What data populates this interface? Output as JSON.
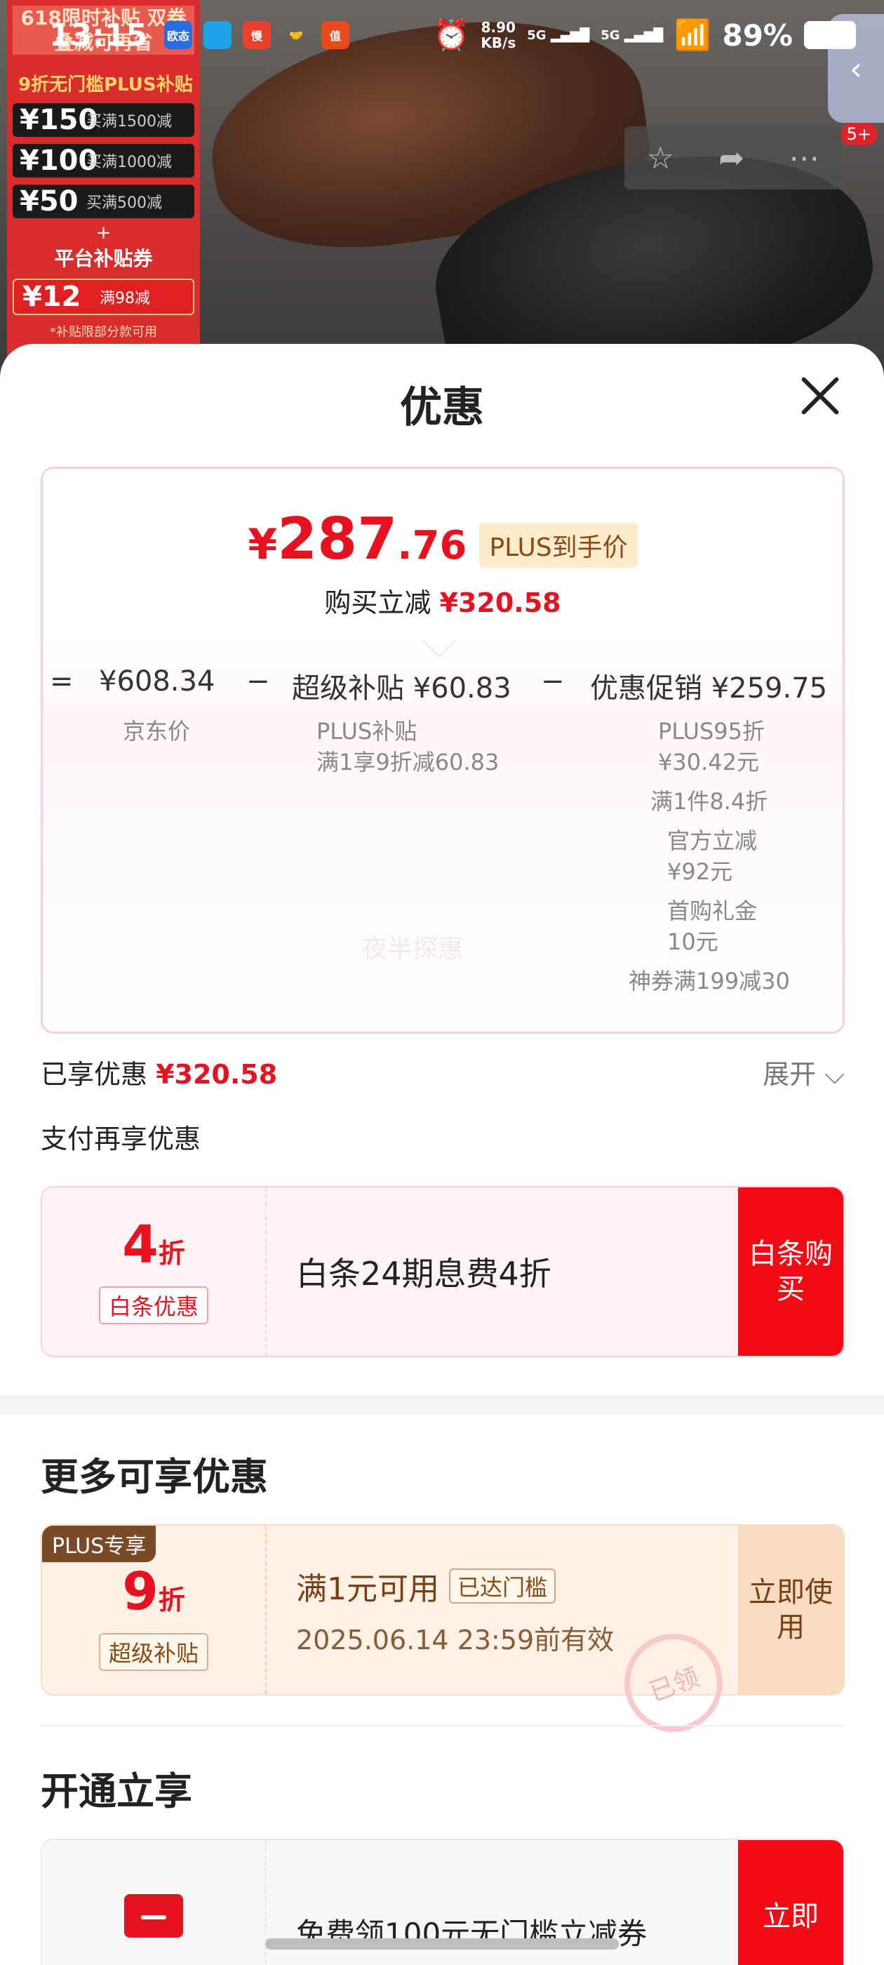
{
  "status_bar": {
    "time": "13:15",
    "net_speed_value": "8.90",
    "net_speed_unit": "KB/s",
    "sig1": "5G",
    "sig2": "5G",
    "battery": "89%",
    "apps": [
      "欧态",
      "",
      "慢",
      "",
      "值"
    ]
  },
  "background": {
    "promo_head": "618限时补贴 双券叠减可再省",
    "promo_tag": "9折无门槛PLUS补贴",
    "promo_rows": [
      {
        "amount": "¥150",
        "cond": "买满1500减"
      },
      {
        "amount": "¥100",
        "cond": "买满1000减"
      },
      {
        "amount": "¥50",
        "cond": "买满500减"
      }
    ],
    "promo_plus": "+",
    "promo_platform": "平台补贴券",
    "promo_coupon": {
      "amount": "¥12",
      "cond": "满98减"
    },
    "promo_foot": "*补贴限部分款可用",
    "badge": "5+",
    "back_icon": "‹"
  },
  "sheet": {
    "title": "优惠",
    "price": {
      "yen": "¥",
      "int": "287",
      "dec": ".76",
      "tag": "PLUS到手价"
    },
    "save": {
      "label": "购买立减 ",
      "value": "¥320.58"
    },
    "formula": {
      "eq": "=",
      "jd_price": "¥608.34",
      "minus1": "−",
      "subsidy": "超级补贴 ¥60.83",
      "minus2": "−",
      "promo": "优惠促销 ¥259.75"
    },
    "jd_price_label": "京东价",
    "subsidy_details": [
      "PLUS补贴",
      "满1享9折减60.83"
    ],
    "promo_details": [
      "PLUS95折",
      "¥30.42元",
      "满1件8.4折",
      "官方立减",
      "¥92元",
      "首购礼金",
      "10元",
      "神券满199减30"
    ],
    "watermark": "夜半探惠",
    "enjoyed_label": "已享优惠 ",
    "enjoyed_value": "¥320.58",
    "expand": "展开 ⌵",
    "pay_more": "支付再享优惠",
    "baitiao": {
      "big": "4",
      "unit": "折",
      "label": "白条优惠",
      "desc": "白条24期息费4折",
      "btn": "白条购买"
    },
    "more_title": "更多可享优惠",
    "plus_coupon": {
      "corner": "PLUS专享",
      "big": "9",
      "unit": "折",
      "label": "超级补贴",
      "cond": "满1元可用",
      "reached": "已达门槛",
      "expire": "2025.06.14 23:59前有效",
      "btn": "立即使用",
      "stamp": "已领"
    },
    "open_title": "开通立享",
    "open_card": {
      "desc": "免费领100元无门槛立减券",
      "btn": "立即"
    }
  }
}
